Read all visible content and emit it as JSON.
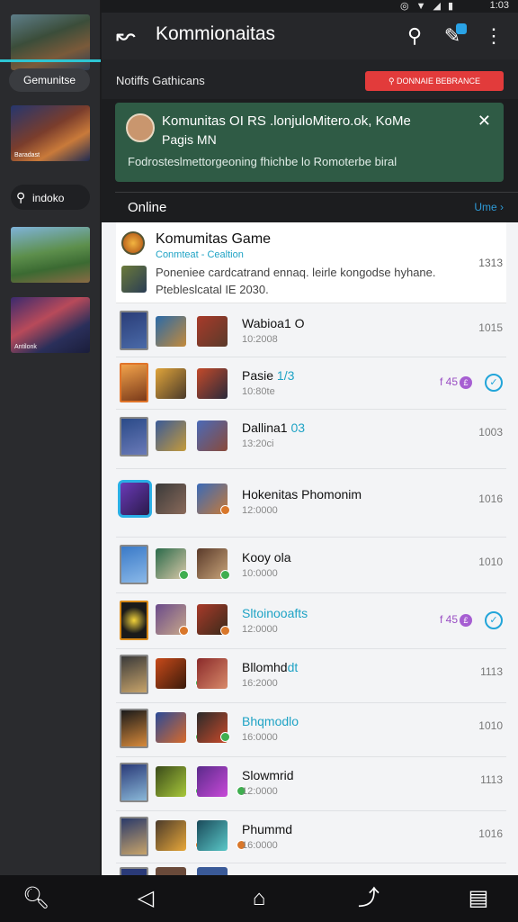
{
  "status_bar": {
    "time": "1:03",
    "icons": [
      "location-icon",
      "wifi-icon",
      "signal-icon",
      "battery-icon"
    ]
  },
  "rail": {
    "active_label": "Gemunitse",
    "search_label": "indoko",
    "thumb_captions": [
      "",
      "Baradast",
      "",
      "Antilonk"
    ]
  },
  "header": {
    "title": "Kommionaitas"
  },
  "notification": {
    "label": "Notiffs Gathicans",
    "button_label": "DONNAIE BEBRANCE",
    "card": {
      "line1": "Komunitas OI RS .lonjuloMitero.ok, KoMe",
      "line2": "Pagis MN",
      "line3": "Fodrosteslmettorgeoning fhichbe lo Romoterbe biral"
    }
  },
  "online": {
    "label": "Online",
    "more": "Ume"
  },
  "featured": {
    "title": "Komumitas Game",
    "subtitle": "Conmteat - Cealtion",
    "body": "Poneniee cardcatrand ennaq. leirle kongodse hyhane. Ptebleslcatal IE 2030.",
    "num": "1313"
  },
  "rows": [
    {
      "name": "Wabioa1 O",
      "name_hl": "",
      "time": "10:2008",
      "num": "1015"
    },
    {
      "name": "Pasie ",
      "name_hl": "1/3",
      "time": "10:80te",
      "num": "",
      "badge": "f 45",
      "check": true
    },
    {
      "name": "Dallina1 ",
      "name_hl": "03",
      "time": "13:20ci",
      "num": "1003"
    },
    {
      "name": "Hokenitas Phomonim",
      "name_hl": "",
      "time": "12:0000",
      "num": "1016"
    },
    {
      "name": "Kooy ola",
      "name_hl": "",
      "time": "10:0000",
      "num": "1010"
    },
    {
      "name": "",
      "name_hl": "Sltoinooafts",
      "time": "12:0000",
      "num": "",
      "badge": "f 45",
      "check": true
    },
    {
      "name": "Bllomhd",
      "name_hl": "dt",
      "time": "16:2000",
      "num": "1113"
    },
    {
      "name": "",
      "name_hl": "Bhqmodlo",
      "time": "16:0000",
      "num": "1010"
    },
    {
      "name": "Slowmrid",
      "name_hl": "",
      "time": "12:0000",
      "num": "1113"
    },
    {
      "name": "Phummd",
      "name_hl": "",
      "time": "16:0000",
      "num": "1016"
    }
  ],
  "colors": {
    "accent": "#2ec5d3",
    "highlight": "#1fa3c5",
    "danger": "#e23b3b",
    "card_green": "#2f5b45"
  }
}
